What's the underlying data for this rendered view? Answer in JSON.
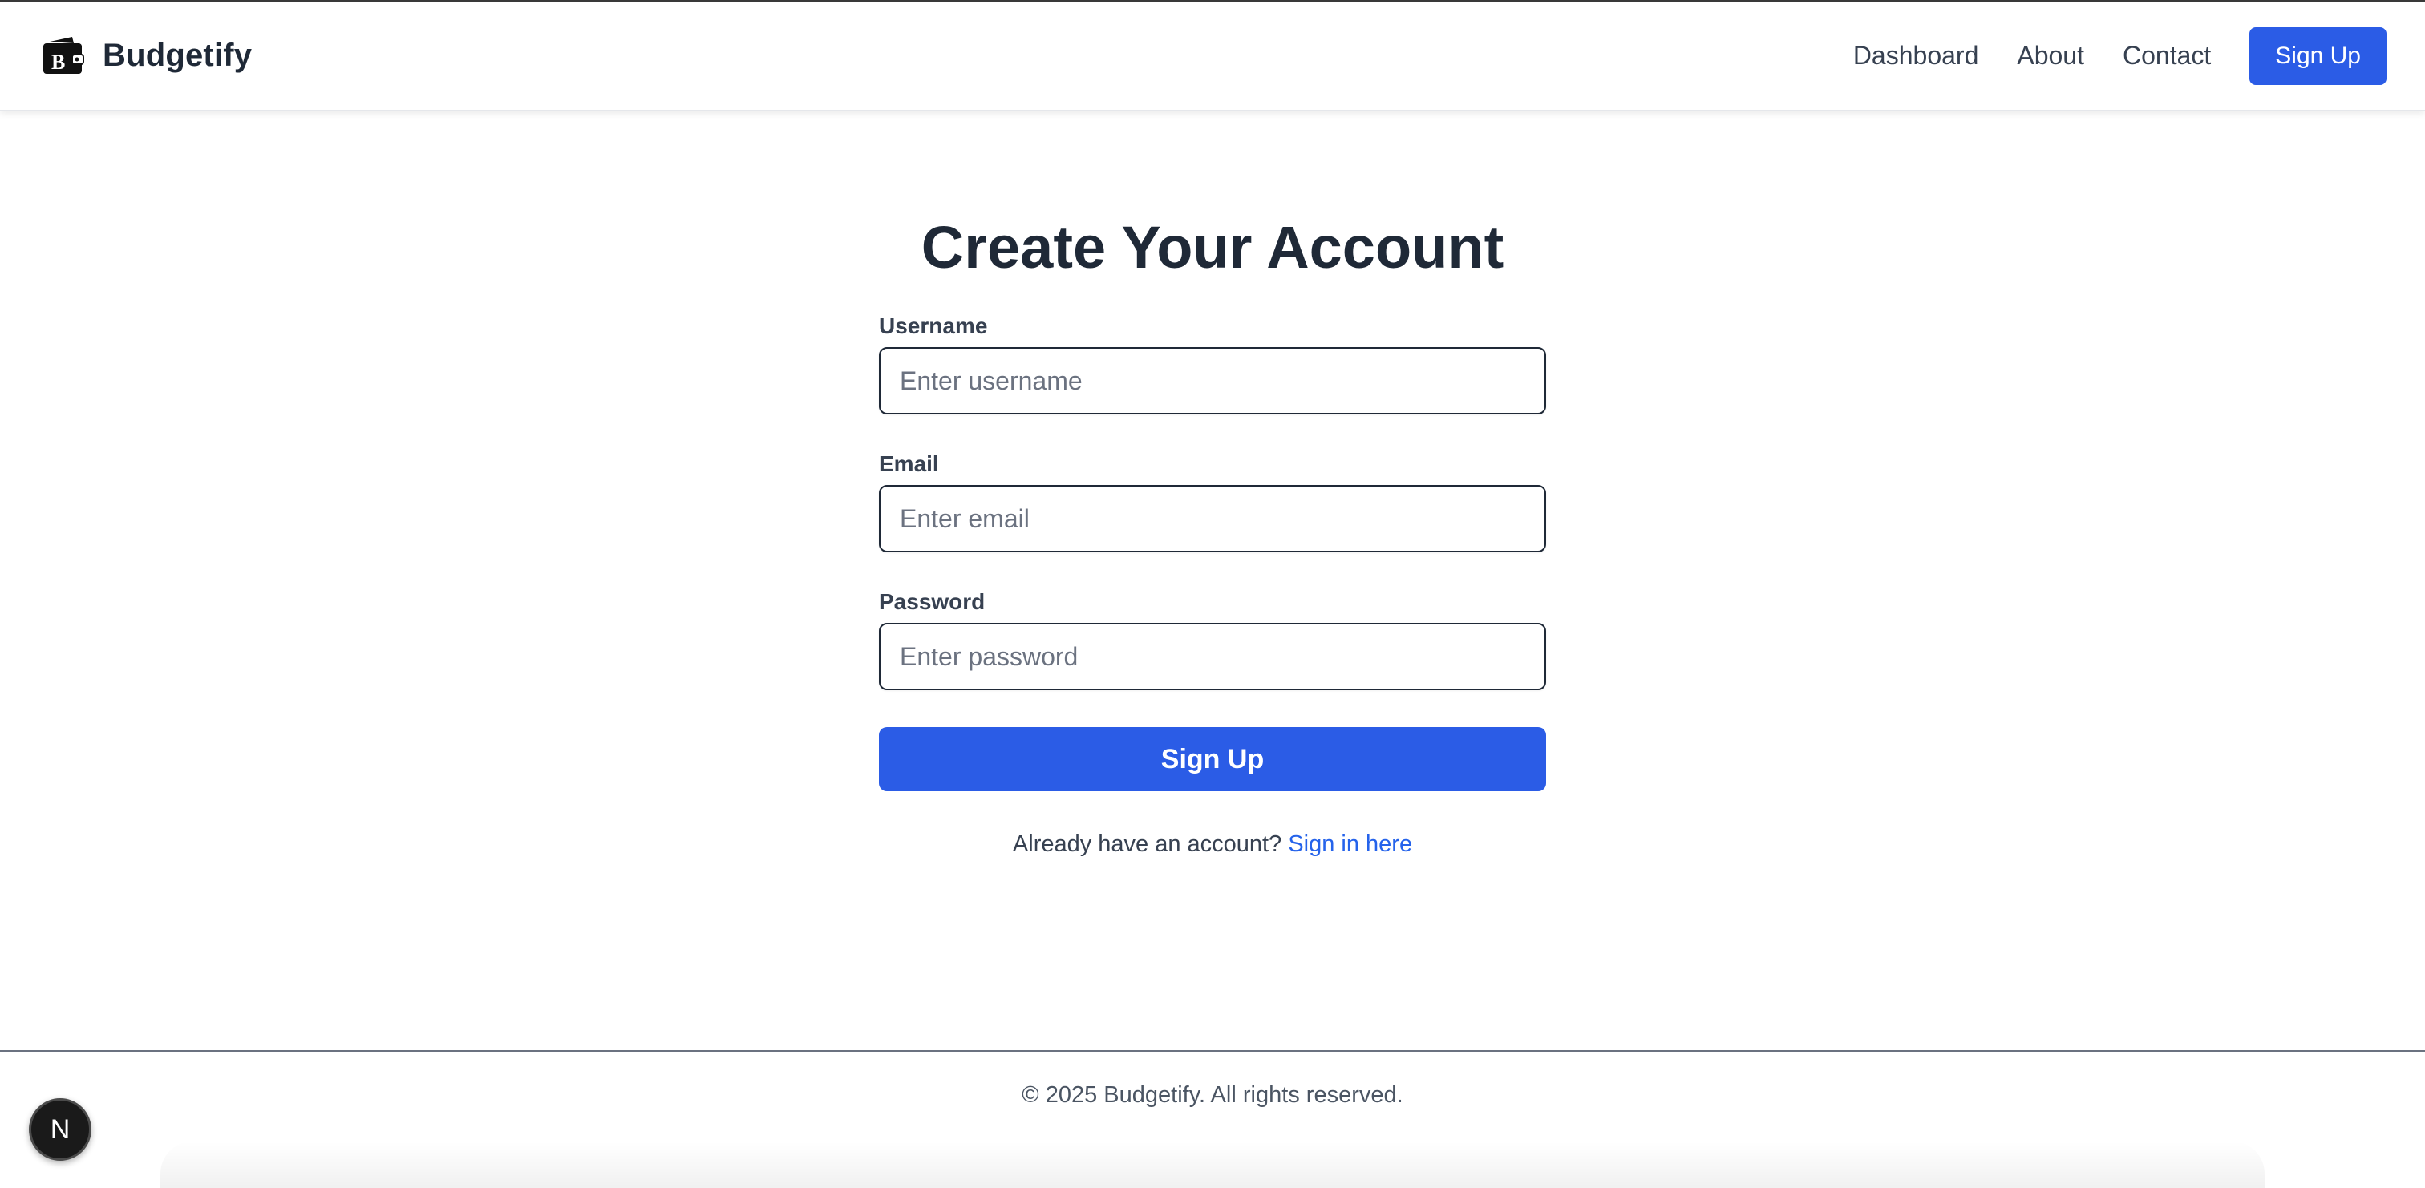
{
  "navbar": {
    "brand": {
      "name": "Budgetify",
      "icon": "wallet-b-icon"
    },
    "links": [
      {
        "label": "Dashboard"
      },
      {
        "label": "About"
      },
      {
        "label": "Contact"
      }
    ],
    "signup_label": "Sign Up"
  },
  "form": {
    "title": "Create Your Account",
    "username": {
      "label": "Username",
      "placeholder": "Enter username",
      "value": ""
    },
    "email": {
      "label": "Email",
      "placeholder": "Enter email",
      "value": ""
    },
    "password": {
      "label": "Password",
      "placeholder": "Enter password",
      "value": ""
    },
    "submit_label": "Sign Up",
    "signin_prompt": "Already have an account?",
    "signin_link": "Sign in here"
  },
  "footer": {
    "text": "© 2025 Budgetify. All rights reserved."
  },
  "dev_badge": {
    "label": "N",
    "icon": "nextjs-icon"
  },
  "colors": {
    "accent": "#2b5ce6",
    "link": "#2563eb",
    "text": "#1f2937"
  }
}
